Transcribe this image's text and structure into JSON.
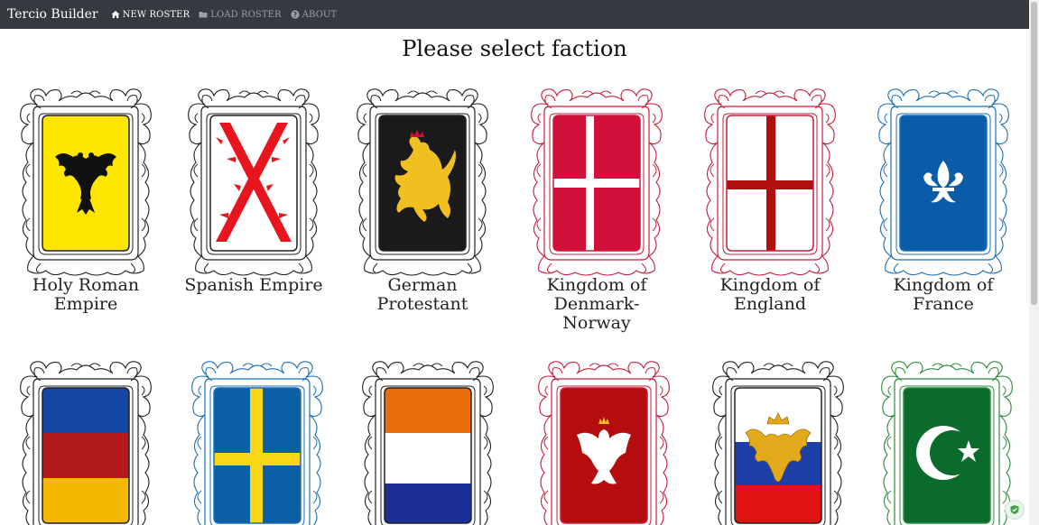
{
  "nav": {
    "brand": "Tercio Builder",
    "items": [
      {
        "label": "NEW ROSTER",
        "icon": "home-icon",
        "active": true
      },
      {
        "label": "LOAD ROSTER",
        "icon": "folder-icon",
        "active": false
      },
      {
        "label": "ABOUT",
        "icon": "question-circle-icon",
        "active": false
      }
    ]
  },
  "title": "Please select faction",
  "factions": [
    {
      "name": "Holy Roman Empire",
      "emblem": "black-double-eagle-on-yellow",
      "frame_color": "#222222"
    },
    {
      "name": "Spanish Empire",
      "emblem": "red-burgundy-cross-on-white",
      "frame_color": "#222222"
    },
    {
      "name": "German Protestant",
      "emblem": "gold-lion-on-black",
      "frame_color": "#222222"
    },
    {
      "name": "Kingdom of Denmark-Norway",
      "emblem": "white-cross-on-red",
      "frame_color": "#c81e3c"
    },
    {
      "name": "Kingdom of England",
      "emblem": "red-cross-on-white",
      "frame_color": "#c81e3c"
    },
    {
      "name": "Kingdom of France",
      "emblem": "white-fleur-de-lis-on-blue",
      "frame_color": "#1f6fb5"
    },
    {
      "name": "",
      "emblem": "blue-red-yellow-tricolor",
      "frame_color": "#222222"
    },
    {
      "name": "",
      "emblem": "yellow-cross-on-blue",
      "frame_color": "#1f6fb5"
    },
    {
      "name": "",
      "emblem": "orange-white-blue-tricolor",
      "frame_color": "#222222"
    },
    {
      "name": "",
      "emblem": "white-eagle-on-red",
      "frame_color": "#c81e3c"
    },
    {
      "name": "",
      "emblem": "gold-double-eagle-white-blue-red",
      "frame_color": "#222222"
    },
    {
      "name": "",
      "emblem": "white-crescent-star-on-green",
      "frame_color": "#2e8b3e"
    }
  ],
  "colors": {
    "navbar": "#343a40",
    "yellow": "#ffe600",
    "red": "#d0103a",
    "burgundy_red": "#e8141e",
    "england_red": "#b10e0e",
    "blue": "#0a5ca8",
    "sweden_blue": "#0b5fa5",
    "sweden_yellow": "#f9d616",
    "orange": "#e96d0a",
    "dutch_blue": "#1b2f95",
    "green": "#0a6b2c",
    "black": "#1a1a1a",
    "gold": "#f0c020"
  }
}
